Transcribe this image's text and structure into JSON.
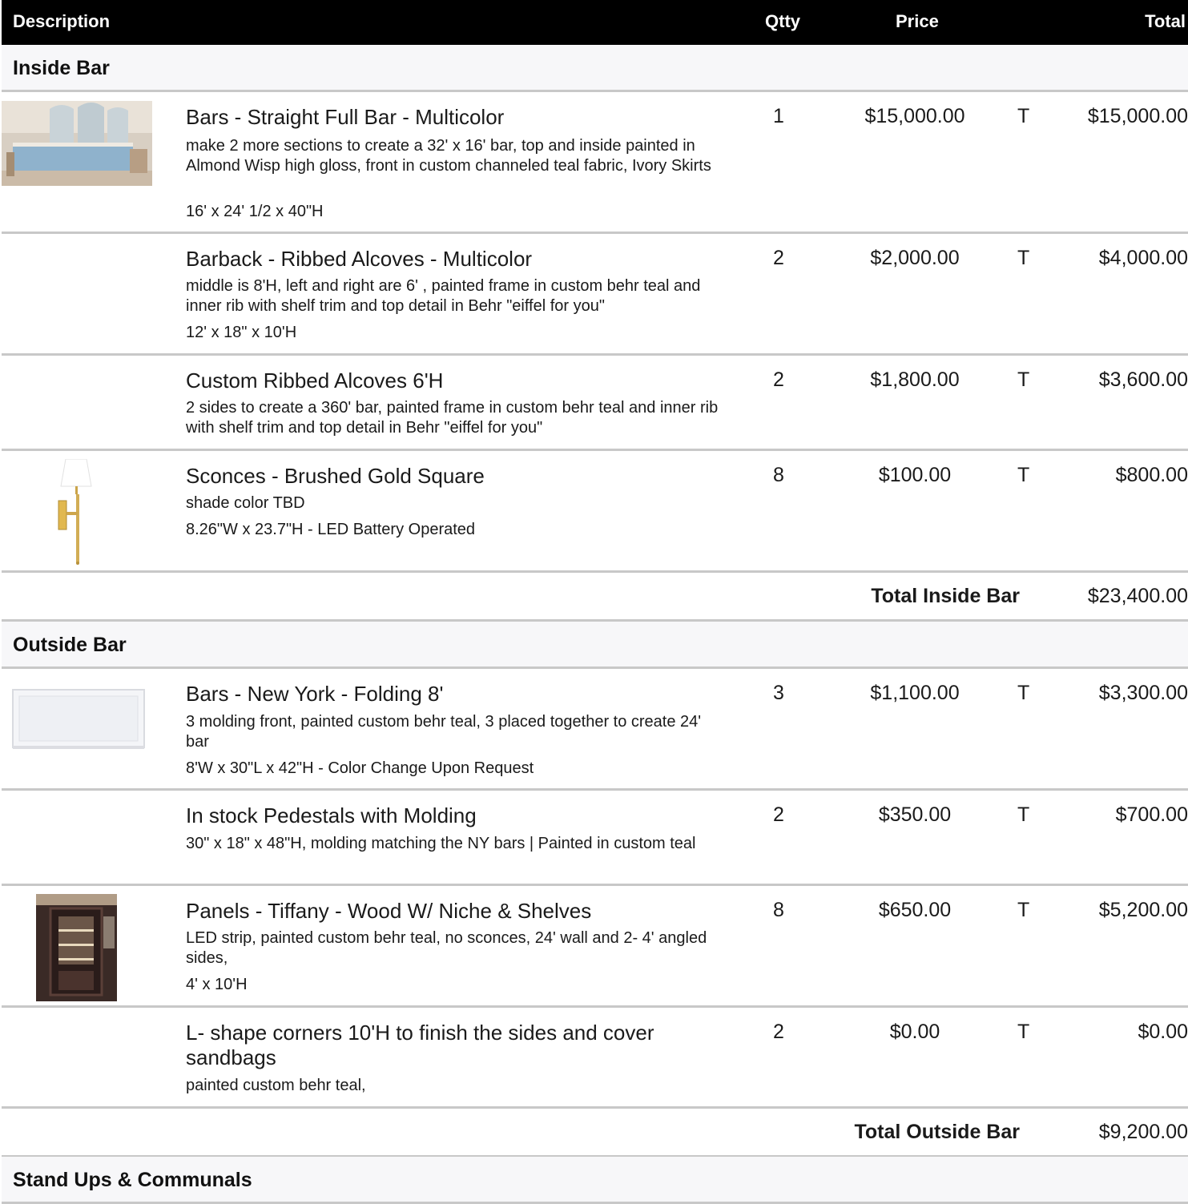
{
  "header": {
    "description": "Description",
    "qty": "Qtty",
    "price": "Price",
    "total": "Total"
  },
  "sections": [
    {
      "name": "Inside Bar",
      "items": [
        {
          "title": "Bars - Straight Full Bar - Multicolor",
          "description": "make 2 more sections to create a 32' x 16' bar, top and inside painted in Almond Wisp high gloss, front in custom channeled teal fabric, Ivory Skirts",
          "dimensions": "16' x 24' 1/2 x 40\"H",
          "qty": "1",
          "price": "$15,000.00",
          "tax": "T",
          "total": "$15,000.00",
          "image": "bar-photo"
        },
        {
          "title": "Barback - Ribbed Alcoves - Multicolor",
          "description": "middle is 8'H, left and right are 6' , painted frame in custom behr teal and inner rib with shelf trim and top detail in Behr \"eiffel for you\"",
          "dimensions": "12' x 18\" x 10'H",
          "qty": "2",
          "price": "$2,000.00",
          "tax": "T",
          "total": "$4,000.00"
        },
        {
          "title": "Custom Ribbed Alcoves 6'H",
          "description": "2 sides to create a 360' bar, painted frame in custom behr teal and inner rib with shelf trim and top detail in Behr \"eiffel for you\"",
          "dimensions": "",
          "qty": "2",
          "price": "$1,800.00",
          "tax": "T",
          "total": "$3,600.00"
        },
        {
          "title": "Sconces - Brushed Gold Square",
          "description": "shade color TBD",
          "dimensions": "8.26\"W x 23.7\"H - LED Battery Operated",
          "qty": "8",
          "price": "$100.00",
          "tax": "T",
          "total": "$800.00",
          "image": "sconce-photo"
        }
      ],
      "total_label": "Total Inside Bar",
      "total": "$23,400.00"
    },
    {
      "name": "Outside Bar",
      "items": [
        {
          "title": "Bars - New York -  Folding 8'",
          "description": "3 molding front, painted custom behr teal,  3 placed together to create 24' bar",
          "dimensions": "8'W x 30\"L x 42\"H - Color Change Upon Request",
          "qty": "3",
          "price": "$1,100.00",
          "tax": "T",
          "total": "$3,300.00",
          "image": "ny-bar-photo"
        },
        {
          "title": "In stock Pedestals with Molding",
          "description": "30\" x 18\" x 48\"H, molding matching the NY bars | Painted in custom teal",
          "dimensions": "",
          "qty": "2",
          "price": "$350.00",
          "tax": "T",
          "total": "$700.00"
        },
        {
          "title": "Panels - Tiffany - Wood W/ Niche & Shelves",
          "description": "LED strip, painted custom behr teal, no sconces, 24' wall and 2- 4' angled sides,",
          "dimensions": "4' x 10'H",
          "qty": "8",
          "price": "$650.00",
          "tax": "T",
          "total": "$5,200.00",
          "image": "panel-photo"
        },
        {
          "title": "L- shape corners 10'H to finish the sides and cover sandbags",
          "description": "painted custom behr teal,",
          "dimensions": "",
          "qty": "2",
          "price": "$0.00",
          "tax": "T",
          "total": "$0.00"
        }
      ],
      "total_label": "Total Outside Bar",
      "total": "$9,200.00"
    },
    {
      "name": "Stand Ups & Communals",
      "items": []
    }
  ]
}
